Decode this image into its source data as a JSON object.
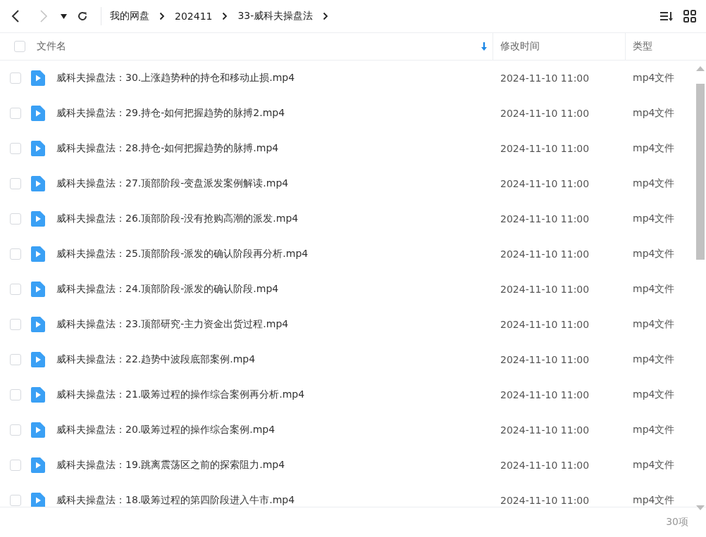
{
  "breadcrumb": [
    "我的网盘",
    "202411",
    "33-威科夫操盘法"
  ],
  "table": {
    "columns": [
      {
        "label": "文件名",
        "sorted": true
      },
      {
        "label": "修改时间",
        "sorted": false
      },
      {
        "label": "类型",
        "sorted": false
      }
    ],
    "select_all": {
      "checked": false
    },
    "rows": [
      {
        "name": "威科夫操盘法：30.上涨趋势种的持仓和移动止损.mp4",
        "modified": "2024-11-10 11:00",
        "type": "mp4文件",
        "checked": false
      },
      {
        "name": "威科夫操盘法：29.持仓-如何把握趋势的脉搏2.mp4",
        "modified": "2024-11-10 11:00",
        "type": "mp4文件",
        "checked": false
      },
      {
        "name": "威科夫操盘法：28.持仓-如何把握趋势的脉搏.mp4",
        "modified": "2024-11-10 11:00",
        "type": "mp4文件",
        "checked": false
      },
      {
        "name": "威科夫操盘法：27.顶部阶段-变盘派发案例解读.mp4",
        "modified": "2024-11-10 11:00",
        "type": "mp4文件",
        "checked": false
      },
      {
        "name": "威科夫操盘法：26.顶部阶段-没有抢购高潮的派发.mp4",
        "modified": "2024-11-10 11:00",
        "type": "mp4文件",
        "checked": false
      },
      {
        "name": "威科夫操盘法：25.顶部阶段-派发的确认阶段再分析.mp4",
        "modified": "2024-11-10 11:00",
        "type": "mp4文件",
        "checked": false
      },
      {
        "name": "威科夫操盘法：24.顶部阶段-派发的确认阶段.mp4",
        "modified": "2024-11-10 11:00",
        "type": "mp4文件",
        "checked": false
      },
      {
        "name": "威科夫操盘法：23.顶部研究-主力资金出货过程.mp4",
        "modified": "2024-11-10 11:00",
        "type": "mp4文件",
        "checked": false
      },
      {
        "name": "威科夫操盘法：22.趋势中波段底部案例.mp4",
        "modified": "2024-11-10 11:00",
        "type": "mp4文件",
        "checked": false
      },
      {
        "name": "威科夫操盘法：21.吸筹过程的操作综合案例再分析.mp4",
        "modified": "2024-11-10 11:00",
        "type": "mp4文件",
        "checked": false
      },
      {
        "name": "威科夫操盘法：20.吸筹过程的操作综合案例.mp4",
        "modified": "2024-11-10 11:00",
        "type": "mp4文件",
        "checked": false
      },
      {
        "name": "威科夫操盘法：19.跳离震荡区之前的探索阻力.mp4",
        "modified": "2024-11-10 11:00",
        "type": "mp4文件",
        "checked": false
      },
      {
        "name": "威科夫操盘法：18.吸筹过程的第四阶段进入牛市.mp4",
        "modified": "2024-11-10 11:00",
        "type": "mp4文件",
        "checked": false
      }
    ]
  },
  "status_bar": {
    "count": "30项"
  }
}
